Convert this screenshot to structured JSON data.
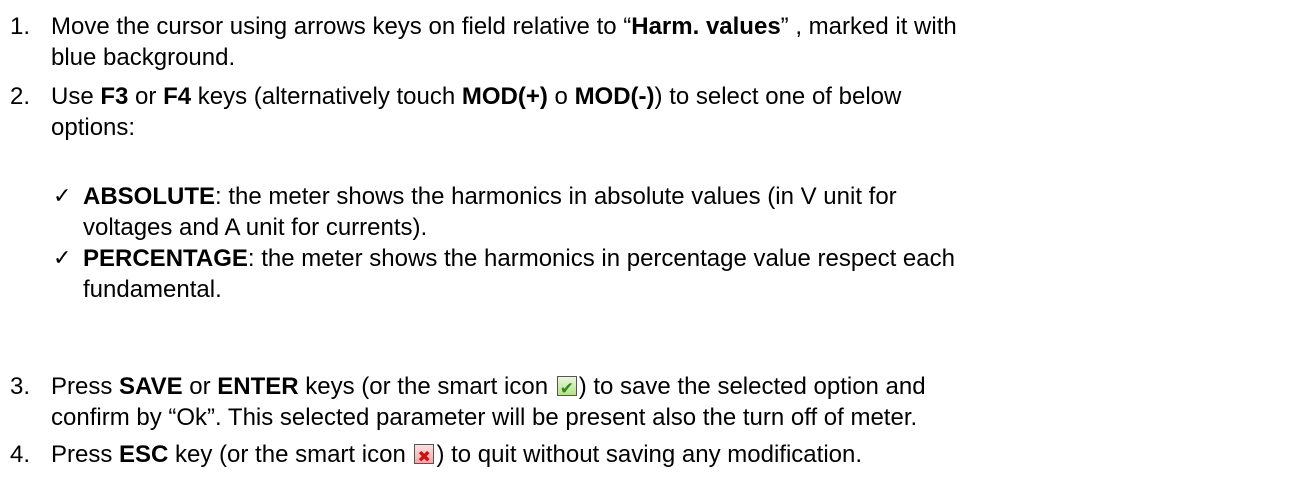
{
  "steps": [
    {
      "number": "1.",
      "line1": [
        "Move the cursor using arrows keys on field relative to “",
        "Harm. values",
        "” , marked it with"
      ],
      "line2": "blue background."
    },
    {
      "number": "2.",
      "line1": [
        "Use ",
        "F3",
        " or ",
        "F4",
        " keys (alternatively touch ",
        "MOD(+)",
        " o ",
        "MOD(-)",
        ") to select one of below"
      ],
      "line2": "options:"
    },
    {
      "number": "3.",
      "line1": [
        "Press ",
        "SAVE",
        " or ",
        "ENTER",
        " keys (or the smart icon ",
        ") to save the selected option and"
      ],
      "line2": "confirm by “Ok”. This selected parameter will be present also the turn off of meter.",
      "icon": "confirm-check-icon"
    },
    {
      "number": "4.",
      "line1": [
        "Press ",
        "ESC",
        " key (or the smart icon ",
        ") to quit without saving any modification."
      ],
      "icon": "cancel-x-icon"
    }
  ],
  "options": [
    {
      "bullet": "✓",
      "term": "ABSOLUTE",
      "line1": ": the meter shows the harmonics in absolute values (in V unit for",
      "line2": "voltages and A unit for currents)."
    },
    {
      "bullet": "✓",
      "term": "PERCENTAGE",
      "line1": ": the meter shows the harmonics in percentage value respect each",
      "line2": "fundamental."
    }
  ]
}
